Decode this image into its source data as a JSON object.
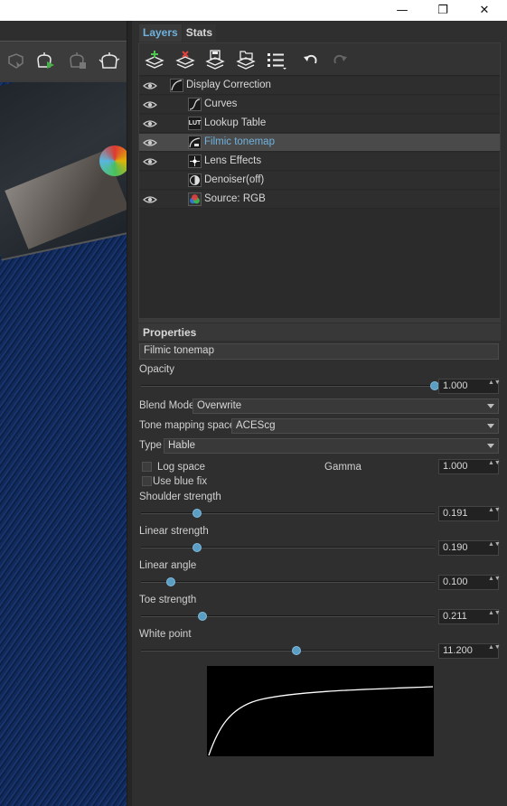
{
  "window": {
    "minimize_glyph": "—",
    "maximize_glyph": "❐",
    "close_glyph": "✕"
  },
  "tabs": [
    {
      "label": "Layers",
      "active": true
    },
    {
      "label": "Stats",
      "active": false
    }
  ],
  "layers": [
    {
      "name": "Display Correction",
      "visible": true,
      "icon": "curve-group-icon",
      "indent": 0,
      "selected": false
    },
    {
      "name": "Curves",
      "visible": true,
      "icon": "curves-icon",
      "indent": 1,
      "selected": false
    },
    {
      "name": "Lookup Table",
      "visible": true,
      "icon": "lut-icon",
      "indent": 1,
      "selected": false
    },
    {
      "name": "Filmic tonemap",
      "visible": true,
      "icon": "filmic-icon",
      "indent": 1,
      "selected": true
    },
    {
      "name": "Lens Effects",
      "visible": true,
      "icon": "lens-effects-icon",
      "indent": 1,
      "selected": false
    },
    {
      "name": "Denoiser(off)",
      "visible": false,
      "icon": "denoiser-icon",
      "indent": 1,
      "selected": false
    },
    {
      "name": "Source: RGB",
      "visible": true,
      "icon": "rgb-source-icon",
      "indent": 1,
      "selected": false
    }
  ],
  "lut_thumb_text": "LUT",
  "properties": {
    "header": "Properties",
    "layer_name": "Filmic tonemap",
    "opacity": {
      "label": "Opacity",
      "value": "1.000",
      "fraction": 1.0
    },
    "blend_mode": {
      "label": "Blend Mode",
      "value": "Overwrite"
    },
    "tone_mapping_space": {
      "label": "Tone mapping space",
      "value": "ACEScg"
    },
    "type": {
      "label": "Type",
      "value": "Hable"
    },
    "log_space": {
      "label": "Log space",
      "checked": false
    },
    "gamma": {
      "label": "Gamma",
      "value": "1.000"
    },
    "use_blue_fix": {
      "label": "Use blue fix",
      "checked": false
    },
    "shoulder_strength": {
      "label": "Shoulder strength",
      "value": "0.191",
      "fraction": 0.19
    },
    "linear_strength": {
      "label": "Linear strength",
      "value": "0.190",
      "fraction": 0.19
    },
    "linear_angle": {
      "label": "Linear angle",
      "value": "0.100",
      "fraction": 0.1
    },
    "toe_strength": {
      "label": "Toe strength",
      "value": "0.211",
      "fraction": 0.21
    },
    "white_point": {
      "label": "White point",
      "value": "11.200",
      "fraction": 0.53
    }
  },
  "spin_arrows": "▲▼"
}
